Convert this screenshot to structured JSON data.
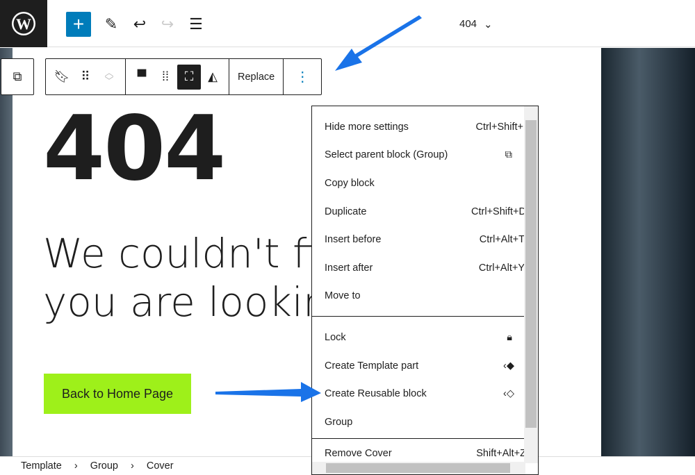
{
  "header": {
    "title": "404",
    "add_label": "+"
  },
  "toolbar": {
    "replace": "Replace"
  },
  "content": {
    "big_title": "404",
    "heading_line1": "We couldn't find",
    "heading_line2": "you are looking",
    "button": "Back to Home Page"
  },
  "menu": {
    "items": [
      {
        "label": "Hide more settings",
        "shortcut": "Ctrl+Shift+,"
      },
      {
        "label": "Select parent block (Group)",
        "icon": "parent-block-icon"
      },
      {
        "label": "Copy block"
      },
      {
        "label": "Duplicate",
        "shortcut": "Ctrl+Shift+D"
      },
      {
        "label": "Insert before",
        "shortcut": "Ctrl+Alt+T"
      },
      {
        "label": "Insert after",
        "shortcut": "Ctrl+Alt+Y"
      },
      {
        "label": "Move to"
      },
      {
        "label": "Lock",
        "icon": "lock-icon"
      },
      {
        "label": "Create Template part",
        "icon": "template-part-icon"
      },
      {
        "label": "Create Reusable block",
        "icon": "reusable-block-icon"
      },
      {
        "label": "Group"
      },
      {
        "label": "Remove Cover",
        "shortcut": "Shift+Alt+Z"
      }
    ]
  },
  "breadcrumb": [
    "Template",
    "Group",
    "Cover"
  ],
  "colors": {
    "accent": "#007cba",
    "button": "#9ef01a",
    "arrow": "#1a73e8"
  }
}
